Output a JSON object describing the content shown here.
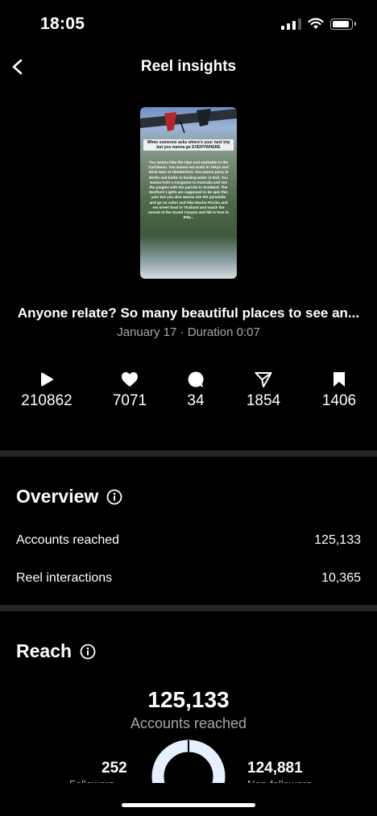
{
  "status_bar": {
    "time": "18:05"
  },
  "nav": {
    "title": "Reel insights"
  },
  "reel": {
    "thumbnail_heading": "When someone asks where's your next trip but you wanna go EVERYWHERE",
    "thumbnail_body": "You wanna hike the Alps and sunbathe in the Caribbean. You wanna eat sushi in Tokyo and drink beer at Oktoberfest. You wanna party in Berlin and bathe in healing water in Bali. You wanna hold a Kangaroo in Australia and see the jungles with the parrots in Scotland. The Northern Lights are supposed to be epic this year but you also wanna see the pyramids and go on safari and hike Machu Picchu and eat street food in Thailand and watch the sunset at the Grand Canyon and fall in love in Italy...",
    "caption": "Anyone relate? So many beautiful places to see an...",
    "meta": "January 17 · Duration 0:07"
  },
  "stats": [
    {
      "icon": "play-icon",
      "value": "210862"
    },
    {
      "icon": "heart-icon",
      "value": "7071"
    },
    {
      "icon": "comment-icon",
      "value": "34"
    },
    {
      "icon": "share-icon",
      "value": "1854"
    },
    {
      "icon": "bookmark-icon",
      "value": "1406"
    }
  ],
  "overview": {
    "title": "Overview",
    "rows": [
      {
        "label": "Accounts reached",
        "value": "125,133"
      },
      {
        "label": "Reel interactions",
        "value": "10,365"
      }
    ]
  },
  "reach": {
    "title": "Reach",
    "total": "125,133",
    "total_label": "Accounts reached",
    "followers": "252",
    "followers_label": "Followers",
    "non_followers": "124,881",
    "non_followers_label": "Non-followers",
    "colors": {
      "followers": "#3b5bdb",
      "non_followers": "#e6f0ff"
    }
  }
}
